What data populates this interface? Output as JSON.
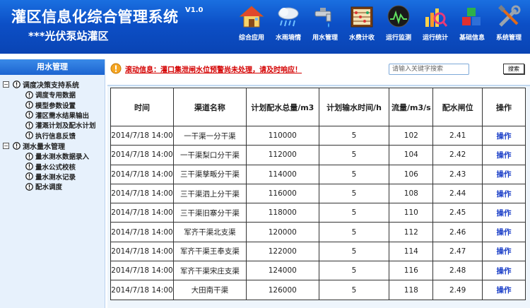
{
  "header": {
    "title": "灌区信息化综合管理系统",
    "version": "V1.0",
    "subtitle": "***光伏泵站灌区"
  },
  "nav": [
    {
      "label": "综合应用",
      "icon": "house-icon"
    },
    {
      "label": "水雨墒情",
      "icon": "rain-cloud-icon"
    },
    {
      "label": "用水管理",
      "icon": "faucet-icon"
    },
    {
      "label": "水费计收",
      "icon": "abacus-icon"
    },
    {
      "label": "运行监测",
      "icon": "monitor-icon"
    },
    {
      "label": "运行统计",
      "icon": "chart-magnifier-icon"
    },
    {
      "label": "基础信息",
      "icon": "cubes-icon"
    },
    {
      "label": "系统管理",
      "icon": "tools-icon"
    }
  ],
  "sidebar": {
    "title": "用水管理",
    "groups": [
      {
        "label": "调度决策支持系统",
        "toggle": "−",
        "items": [
          "调度专用数据",
          "模型参数设置",
          "灌区需水结果输出",
          "灌溉计划及配水计划",
          "执行信息反馈"
        ]
      },
      {
        "label": "测水量水管理",
        "toggle": "−",
        "items": [
          "量水测水数据录入",
          "量水公式校核",
          "量水测水记录",
          "配水调度"
        ]
      }
    ]
  },
  "notice": {
    "text": "滚动信息：灌口集泄闸水位预警尚未处理，请及时响应！"
  },
  "search": {
    "placeholder": "请输入关键字搜索",
    "button": "搜索"
  },
  "table": {
    "headers": [
      "时间",
      "渠道名称",
      "计划配水总量/m3",
      "计划输水时间/h",
      "流量/m3/s",
      "配水闸位",
      "操作"
    ],
    "rows": [
      [
        "2014/7/18 14:00",
        "一干渠一分干渠",
        "110000",
        "5",
        "102",
        "2.41",
        "操作"
      ],
      [
        "2014/7/18 14:00",
        "一干渠梨口分干渠",
        "112000",
        "5",
        "104",
        "2.42",
        "操作"
      ],
      [
        "2014/7/18 14:00",
        "三干渠孳畈分干渠",
        "114000",
        "5",
        "106",
        "2.43",
        "操作"
      ],
      [
        "2014/7/18 14:00",
        "三干渠泗上分干渠",
        "116000",
        "5",
        "108",
        "2.44",
        "操作"
      ],
      [
        "2014/7/18 14:00",
        "三干渠旧寨分干渠",
        "118000",
        "5",
        "110",
        "2.45",
        "操作"
      ],
      [
        "2014/7/18 14:00",
        "军齐干渠北支渠",
        "120000",
        "5",
        "112",
        "2.46",
        "操作"
      ],
      [
        "2014/7/18 14:00",
        "军齐干渠王奉支渠",
        "122000",
        "5",
        "114",
        "2.47",
        "操作"
      ],
      [
        "2014/7/18 14:00",
        "军齐干渠宋庄支渠",
        "124000",
        "5",
        "116",
        "2.48",
        "操作"
      ],
      [
        "2014/7/18 14:00",
        "大田南干渠",
        "126000",
        "5",
        "118",
        "2.49",
        "操作"
      ]
    ]
  },
  "colors": {
    "header_bg": "#0c4fc6",
    "notice_red": "#d40000",
    "link_blue": "#1b3fc8",
    "sidebar_bg": "#e7f1fc"
  }
}
